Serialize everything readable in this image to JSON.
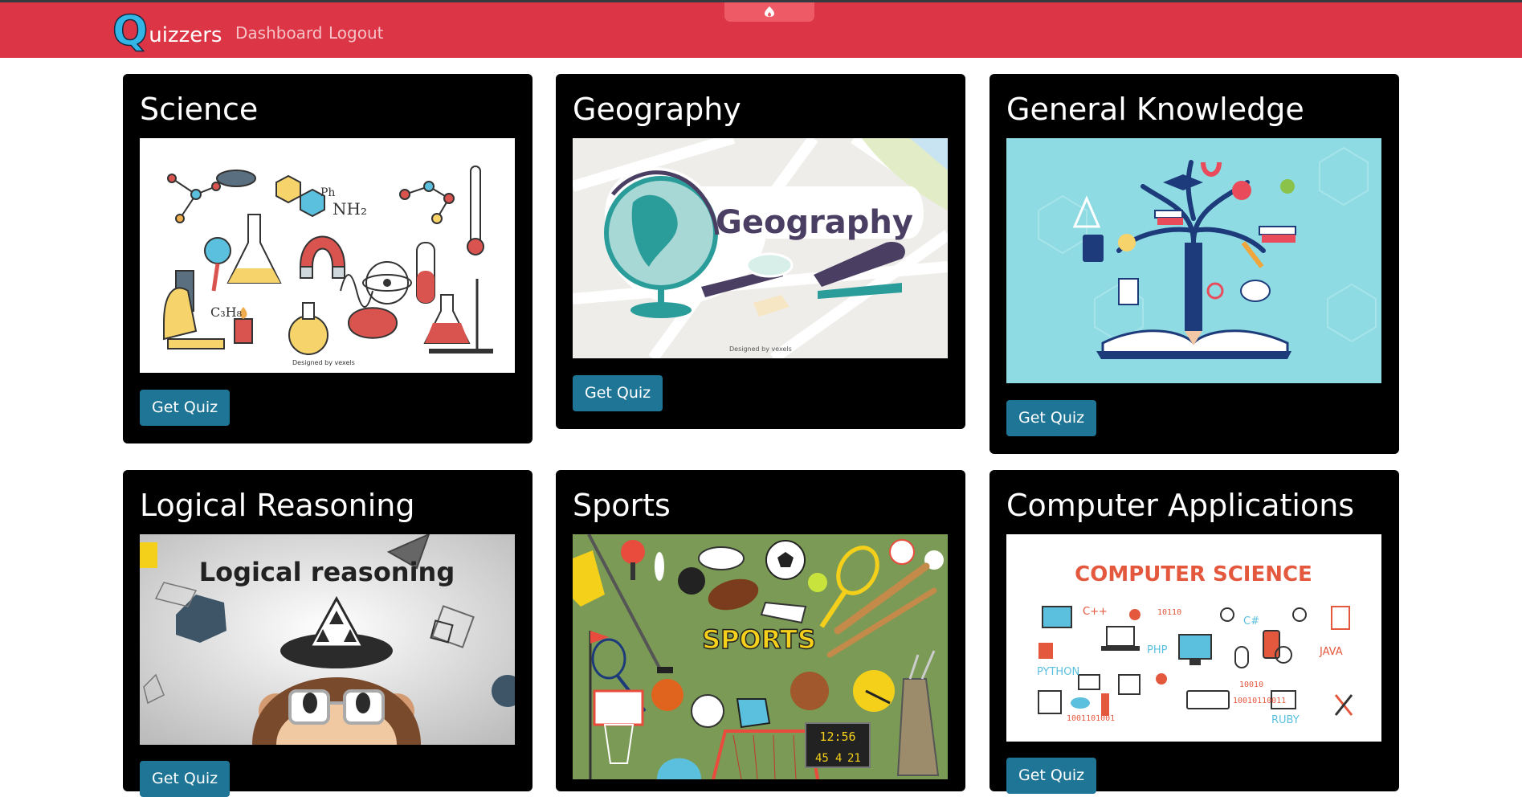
{
  "navbar": {
    "brand_initial": "Q",
    "brand_rest": "uizzers",
    "links": [
      "Dashboard",
      "Logout"
    ]
  },
  "colors": {
    "navbar": "#dc3545",
    "card": "#000000",
    "button": "#1f7596",
    "brand_q": "#33b5e5"
  },
  "quizzes": [
    {
      "title": "Science",
      "button": "Get Quiz",
      "image_text": "",
      "image_credit": "Designed by vexels"
    },
    {
      "title": "Geography",
      "button": "Get Quiz",
      "image_text": "Geography",
      "image_credit": "Designed by vexels"
    },
    {
      "title": "General Knowledge",
      "button": "Get Quiz",
      "image_text": ""
    },
    {
      "title": "Logical Reasoning",
      "button": "Get Quiz",
      "image_text": "Logical reasoning"
    },
    {
      "title": "Sports",
      "button": "Get Quiz",
      "image_text": "SPORTS",
      "scoreboard": [
        "12:56",
        "45",
        "4",
        "21"
      ]
    },
    {
      "title": "Computer Applications",
      "button": "Get Quiz",
      "image_text": "COMPUTER SCIENCE",
      "image_words": [
        "C++",
        "C#",
        "PHP",
        "JAVA",
        "PYTHON",
        "RUBY",
        "10110",
        "1001101001",
        "10010",
        "10010110011"
      ]
    }
  ]
}
